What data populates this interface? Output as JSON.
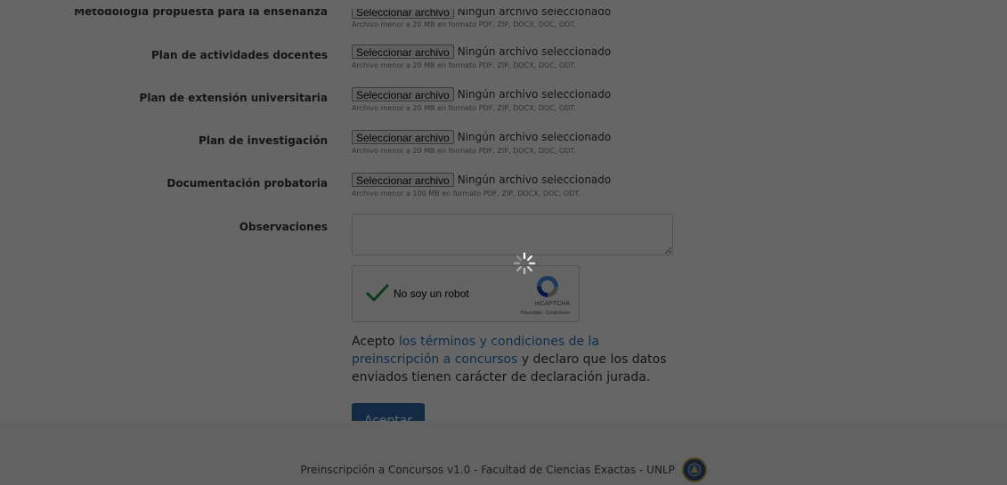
{
  "form": {
    "first_row": {
      "label": "Metodología propuesta para la enseñanza",
      "button_label": "Seleccionar archivo",
      "status": "Ningún archivo seleccionado",
      "hint": "Archivo menor a 20 MB en formato PDF, ZIP, DOCX, DOC, ODT."
    },
    "file_rows": [
      {
        "label": "Plan de actividades docentes",
        "button_label": "Seleccionar archivo",
        "status": "Ningún archivo seleccionado",
        "hint": "Archivo menor a 20 MB en formato PDF, ZIP, DOCX, DOC, ODT."
      },
      {
        "label": "Plan de extensión universitaria",
        "button_label": "Seleccionar archivo",
        "status": "Ningún archivo seleccionado",
        "hint": "Archivo menor a 20 MB en formato PDF, ZIP, DOCX, DOC, ODT."
      },
      {
        "label": "Plan de investigación",
        "button_label": "Seleccionar archivo",
        "status": "Ningún archivo seleccionado",
        "hint": "Archivo menor a 20 MB en formato PDF, ZIP, DOCX, DOC, ODT."
      },
      {
        "label": "Documentación probatoria",
        "button_label": "Seleccionar archivo",
        "status": "Ningún archivo seleccionado",
        "hint": "Archivo menor a 100 MB en formato PDF, ZIP, DOCX, DOC, ODT."
      }
    ],
    "observaciones": {
      "label": "Observaciones",
      "value": ""
    },
    "captcha": {
      "label": "No soy un robot",
      "brand": "reCAPTCHA",
      "links": "Privacidad - Condiciones",
      "checked": true,
      "check_color": "#1e8e3e"
    },
    "terms": {
      "prefix": "Acepto ",
      "link_text": "los términos y condiciones de la preinscripción a concursos",
      "suffix": " y declaro que los datos enviados tienen carácter de declaración jurada."
    },
    "submit_label": "Aceptar"
  },
  "footer": {
    "text": "Preinscripción a Concursos v1.0 - Facultad de Ciencias Exactas - UNLP",
    "logo_icon": "unlp-seal-icon"
  },
  "overlay": {
    "spinner_icon": "loading-spinner-icon",
    "dim_color": "#000000"
  },
  "colors": {
    "link": "#2a72b8",
    "primary_button": "#2f6aab"
  }
}
